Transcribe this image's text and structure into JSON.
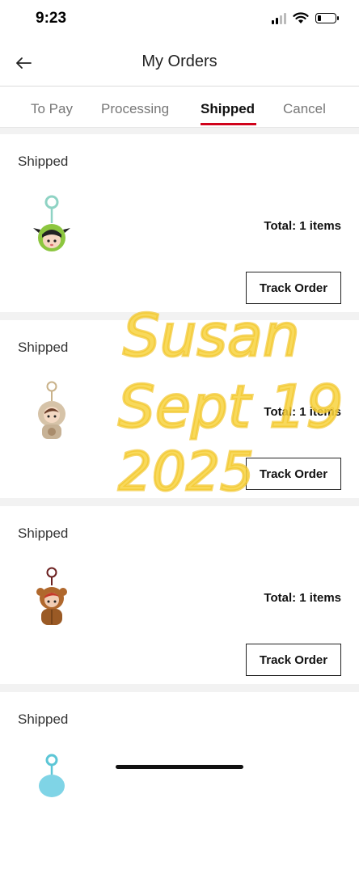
{
  "status_bar": {
    "time": "9:23"
  },
  "header": {
    "title": "My Orders"
  },
  "tabs": [
    {
      "label": "To Pay"
    },
    {
      "label": "Processing"
    },
    {
      "label": "Shipped"
    },
    {
      "label": "Cancel"
    }
  ],
  "orders": [
    {
      "status": "Shipped",
      "total": "Total: 1 items",
      "button": "Track Order",
      "product": "green-hood-doll-keychain"
    },
    {
      "status": "Shipped",
      "total": "Total: 1 items",
      "button": "Track Order",
      "product": "beige-hood-doll-keychain"
    },
    {
      "status": "Shipped",
      "total": "Total: 1 items",
      "button": "Track Order",
      "product": "brown-bear-doll-keychain"
    },
    {
      "status": "Shipped",
      "product": "blue-doll-keychain"
    }
  ],
  "overlay": {
    "handwriting": [
      "Susan",
      "Sept 19",
      "2025"
    ],
    "color": "#f7d23e"
  },
  "colors": {
    "accent": "#d0021b",
    "separator": "#f2f2f2"
  }
}
